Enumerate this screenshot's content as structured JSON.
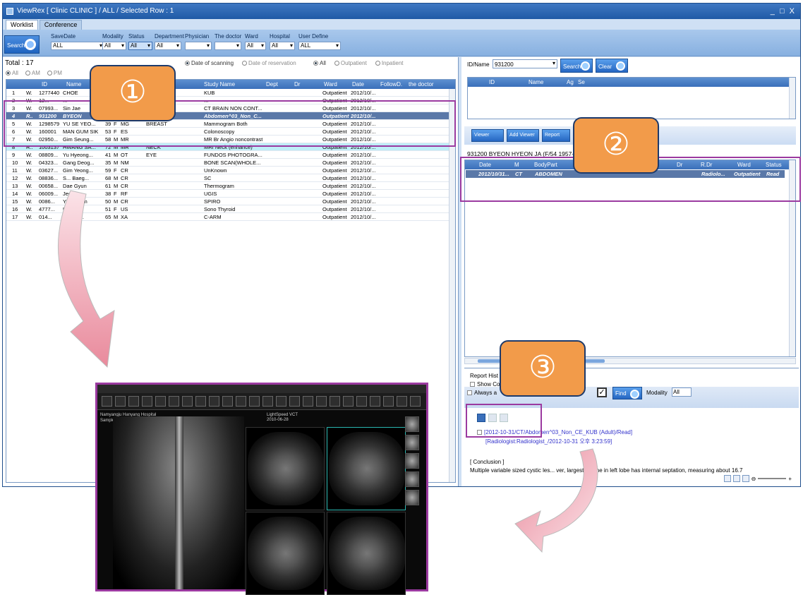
{
  "window": {
    "title": "ViewRex [ Clinic CLINIC ] / ALL / Selected Row : 1",
    "controls": "_ □ X"
  },
  "tabs": [
    "Worklist",
    "Conference"
  ],
  "search_button": "Search",
  "filters": {
    "savedate": {
      "label": "SaveDate",
      "value": "ALL"
    },
    "modality": {
      "label": "Modality",
      "value": "All"
    },
    "status": {
      "label": "Status",
      "value": "All"
    },
    "department": {
      "label": "Department",
      "value": "All"
    },
    "physician": {
      "label": "Physician",
      "value": ""
    },
    "doctor": {
      "label": "The doctor",
      "value": ""
    },
    "ward": {
      "label": "Ward",
      "value": "All"
    },
    "hospital": {
      "label": "Hospital",
      "value": "All"
    },
    "userdefine": {
      "label": "User Define",
      "value": "ALL"
    }
  },
  "total": "Total : 17",
  "time_radios": [
    "All",
    "AM",
    "PM"
  ],
  "date_opts": {
    "scanning": "Date of scanning",
    "reservation": "Date of reservation"
  },
  "patient_opts": {
    "all": "All",
    "outpatient": "Outpatient",
    "inpatient": "Inpatient"
  },
  "worklist": {
    "columns": [
      "ID",
      "Name",
      "Study Name",
      "Dept",
      "Dr",
      "Ward",
      "Date",
      "FollowD.",
      "the doctor"
    ],
    "rows": [
      {
        "no": "1",
        "st": "W.",
        "id": "1277440",
        "name": "CHOE",
        "age": "",
        "sex": "",
        "mod": "",
        "body": "",
        "study": "KUB",
        "ward": "Outpatient",
        "date": "2012/10/..."
      },
      {
        "no": "2",
        "st": "W.",
        "id": "12...",
        "name": "...",
        "age": "",
        "sex": "",
        "mod": "",
        "body": "",
        "study": "...",
        "ward": "Outpatient",
        "date": "2012/10/..."
      },
      {
        "no": "3",
        "st": "W.",
        "id": "07993...",
        "name": "Sin Jae",
        "age": "",
        "sex": "",
        "mod": "",
        "body": "",
        "study": "CT BRAIN NON CONT...",
        "ward": "Outpatient",
        "date": "2012/10/..."
      },
      {
        "no": "4",
        "st": "R..",
        "id": "931200",
        "name": "BYEON",
        "age": "",
        "sex": "",
        "mod": "",
        "body": "",
        "study": "Abdomen^03_Non_C...",
        "ward": "Outpatient",
        "date": "2012/10/..."
      },
      {
        "no": "5",
        "st": "W.",
        "id": "1298579",
        "name": "YU SE YEO...",
        "age": "39",
        "sex": "F",
        "mod": "MG",
        "body": "BREAST",
        "study": "Mammogram Both",
        "ward": "Outpatient",
        "date": "2012/10/..."
      },
      {
        "no": "6",
        "st": "W.",
        "id": "160001",
        "name": "MAN GUM SIK",
        "age": "53",
        "sex": "F",
        "mod": "ES",
        "body": "",
        "study": "Colonoscopy",
        "ward": "Outpatient",
        "date": "2012/10/..."
      },
      {
        "no": "7",
        "st": "W.",
        "id": "02950...",
        "name": "Gim Seung...",
        "age": "58",
        "sex": "M",
        "mod": "MR",
        "body": "",
        "study": "MR Br Angio noncontrast",
        "ward": "Outpatient",
        "date": "2012/10/..."
      },
      {
        "no": "8",
        "st": "R..",
        "id": "1003137",
        "name": "HWANG SA...",
        "age": "72",
        "sex": "M",
        "mod": "MR",
        "body": "NECK",
        "study": "MRI Neck (enhance)",
        "ward": "Outpatient",
        "date": "2012/10/..."
      },
      {
        "no": "9",
        "st": "W.",
        "id": "08809...",
        "name": "Yu Hyeong...",
        "age": "41",
        "sex": "M",
        "mod": "OT",
        "body": "EYE",
        "study": "FUNDOS PHOTOGRA...",
        "ward": "Outpatient",
        "date": "2012/10/..."
      },
      {
        "no": "10",
        "st": "W.",
        "id": "04323...",
        "name": "Gang Deog...",
        "age": "35",
        "sex": "M",
        "mod": "NM",
        "body": "",
        "study": "BONE SCAN(WHOLE...",
        "ward": "Outpatient",
        "date": "2012/10/..."
      },
      {
        "no": "11",
        "st": "W.",
        "id": "03627...",
        "name": "Gim Yeong...",
        "age": "59",
        "sex": "F",
        "mod": "CR",
        "body": "",
        "study": "UnKnown",
        "ward": "Outpatient",
        "date": "2012/10/..."
      },
      {
        "no": "12",
        "st": "W.",
        "id": "08836...",
        "name": "S... Baeg...",
        "age": "68",
        "sex": "M",
        "mod": "CR",
        "body": "",
        "study": "SC",
        "ward": "Outpatient",
        "date": "2012/10/..."
      },
      {
        "no": "13",
        "st": "W.",
        "id": "00658...",
        "name": "Dae Gyun",
        "age": "61",
        "sex": "M",
        "mod": "CR",
        "body": "",
        "study": "Thermogram",
        "ward": "Outpatient",
        "date": "2012/10/..."
      },
      {
        "no": "14",
        "st": "W.",
        "id": "06009...",
        "name": "Jeong",
        "age": "38",
        "sex": "F",
        "mod": "RF",
        "body": "",
        "study": "UGIS",
        "ward": "Outpatient",
        "date": "2012/10/..."
      },
      {
        "no": "15",
        "st": "W.",
        "id": "0086...",
        "name": "Yong Nam",
        "age": "50",
        "sex": "M",
        "mod": "CR",
        "body": "",
        "study": "SPIRO",
        "ward": "Outpatient",
        "date": "2012/10/..."
      },
      {
        "no": "16",
        "st": "W.",
        "id": "4777...",
        "name": "UN JA",
        "age": "51",
        "sex": "F",
        "mod": "US",
        "body": "",
        "study": "Sono Thyroid",
        "ward": "Outpatient",
        "date": "2012/10/..."
      },
      {
        "no": "17",
        "st": "W.",
        "id": "014...",
        "name": "Gwang...",
        "age": "65",
        "sex": "M",
        "mod": "XA",
        "body": "",
        "study": "C-ARM",
        "ward": "Outpatient",
        "date": "2012/10/..."
      }
    ]
  },
  "idsearch": {
    "label": "ID/Name",
    "value": "931200",
    "search": "Search",
    "clear": "Clear"
  },
  "patient_grid_cols": [
    "ID",
    "Name",
    "Ag",
    "Se"
  ],
  "viewer_buttons": {
    "viewer": "Viewer",
    "add": "Add Viewer",
    "report": "Report"
  },
  "patient_info": "931200 BYEON HYEON JA (F/54 1957-",
  "study_grid": {
    "columns": [
      "Date",
      "M",
      "BodyPart",
      "Dr",
      "R.Dr",
      "Ward",
      "Status"
    ],
    "row": {
      "date": "2012/10/31...",
      "m": "CT",
      "body": "ABDOMEN",
      "rdr": "Radiolo...",
      "ward": "Outpatient",
      "status": "Read"
    }
  },
  "report": {
    "history": "Report Hist",
    "show": "Show Co",
    "always": "Always a",
    "find": "Find",
    "modality_label": "Modality",
    "modality_value": "All",
    "entry": "[2012-10-31/CT/Abdomen^03_Non_CE_KUB (Adult)/Read]",
    "entry2": "[Radiologist:Radiologist_/2012-10-31 오후 3:23:59]",
    "conclusion_title": "[ Conclusion ]",
    "conclusion_text": "Multiple variable sized cystic les... ver, largestest one in left lobe has internal septation, measuring about 16.7"
  },
  "callouts": [
    "①",
    "②",
    "③"
  ],
  "viewer_screen": {
    "hospital": "Namyangju Hanyang Hospital",
    "patient": "Sample Data",
    "lightspeed": "LightSpeed VCT",
    "date": "2010-06-28"
  },
  "colors": {
    "accent": "#f29b4a",
    "highlight": "#9b3aa0",
    "selected_row": "#5a78a8"
  }
}
